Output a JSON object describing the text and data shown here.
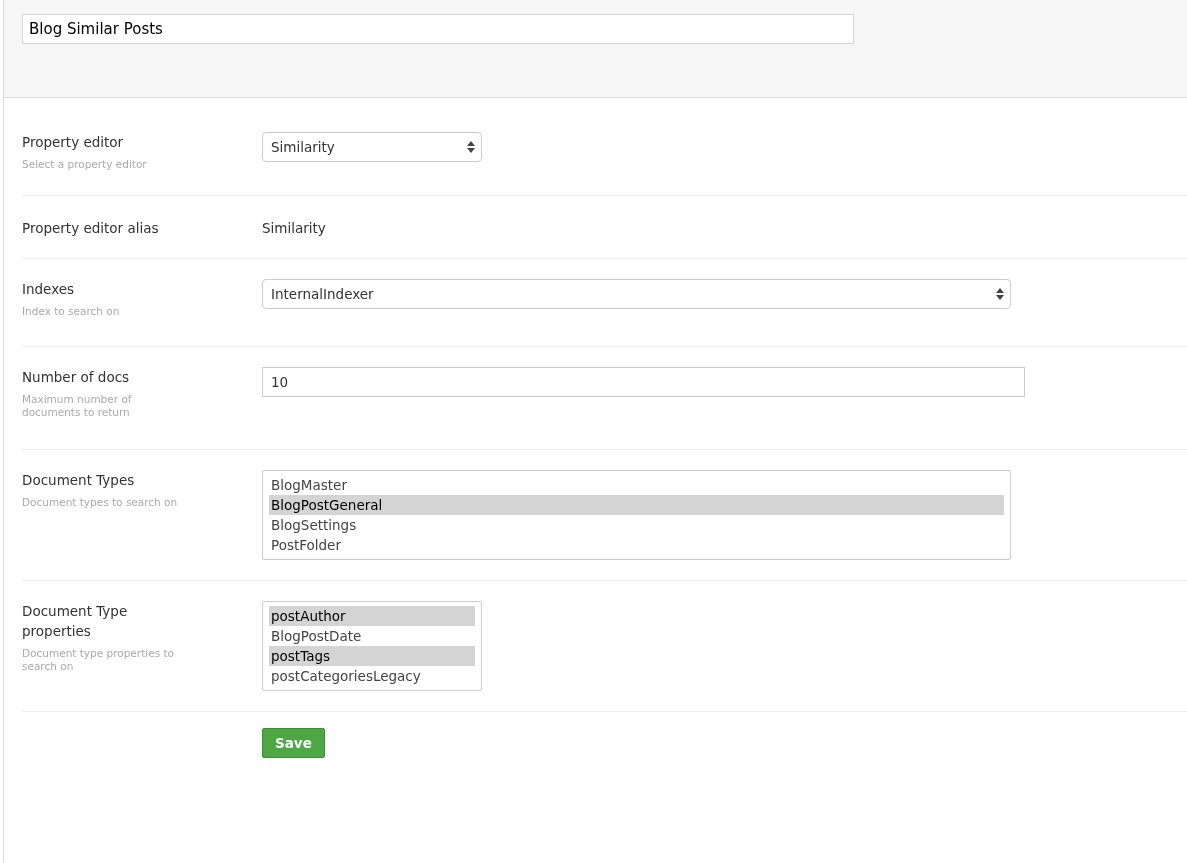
{
  "header": {
    "name_value": "Blog Similar Posts"
  },
  "fields": [
    {
      "kind": "select",
      "label": "Property editor",
      "hint": "Select a property editor",
      "value": "Similarity"
    },
    {
      "kind": "text",
      "label": "Property editor alias",
      "value": "Similarity"
    },
    {
      "kind": "select",
      "label": "Indexes",
      "hint": "Index to search on",
      "value": "InternalIndexer"
    },
    {
      "kind": "input",
      "label": "Number of docs",
      "hint": "Maximum number of documents to return",
      "value": "10"
    },
    {
      "kind": "listbox",
      "label": "Document Types",
      "hint": "Document types to search on",
      "options": [
        {
          "label": "BlogMaster",
          "selected": false
        },
        {
          "label": "BlogPostGeneral",
          "selected": true
        },
        {
          "label": "BlogSettings",
          "selected": false
        },
        {
          "label": "PostFolder",
          "selected": false
        }
      ]
    },
    {
      "kind": "listbox",
      "label": "Document Type properties",
      "hint": "Document type properties to search on",
      "options": [
        {
          "label": "postAuthor",
          "selected": true
        },
        {
          "label": "BlogPostDate",
          "selected": false
        },
        {
          "label": "postTags",
          "selected": true
        },
        {
          "label": "postCategoriesLegacy",
          "selected": false
        }
      ]
    }
  ],
  "save_button": "Save"
}
